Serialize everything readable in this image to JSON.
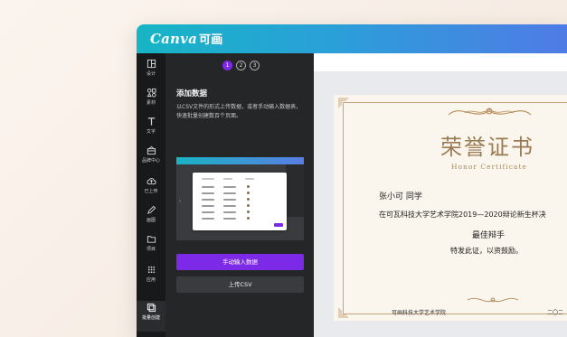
{
  "app": {
    "logo_text": "Canva",
    "logo_cn": "可画"
  },
  "rail": [
    {
      "label": "设计",
      "icon": "layout-icon"
    },
    {
      "label": "素材",
      "icon": "elements-icon"
    },
    {
      "label": "文字",
      "icon": "text-icon"
    },
    {
      "label": "品牌中心",
      "icon": "brand-icon"
    },
    {
      "label": "已上传",
      "icon": "upload-icon"
    },
    {
      "label": "画图",
      "icon": "draw-icon"
    },
    {
      "label": "项目",
      "icon": "folder-icon"
    },
    {
      "label": "应用",
      "icon": "apps-icon"
    },
    {
      "label": "批量创建",
      "icon": "bulk-create-icon"
    }
  ],
  "panel": {
    "steps": [
      "1",
      "2",
      "3"
    ],
    "title": "添加数据",
    "description": "以CSV文件的形式上传数据，或者手动输入数据表，快速批量创建数百个页面。",
    "manual_button": "手动输入数据",
    "csv_button": "上传CSV"
  },
  "certificate": {
    "title": "荣誉证书",
    "subtitle": "Honor Certificate",
    "name_line": "张小可 同学",
    "body_line": "在可瓦科技大学艺术学院2019—2020辩论新生杯决",
    "award": "最佳辩手",
    "commend_line": "特发此证，以资鼓励。",
    "footer_left": "可画科技大学艺术学院",
    "footer_right": "二〇二"
  },
  "colors": {
    "accent": "#7d2ae8",
    "topbar_start": "#17b5c5",
    "topbar_end": "#4f7be6",
    "cert_gold": "#9a7a52"
  }
}
